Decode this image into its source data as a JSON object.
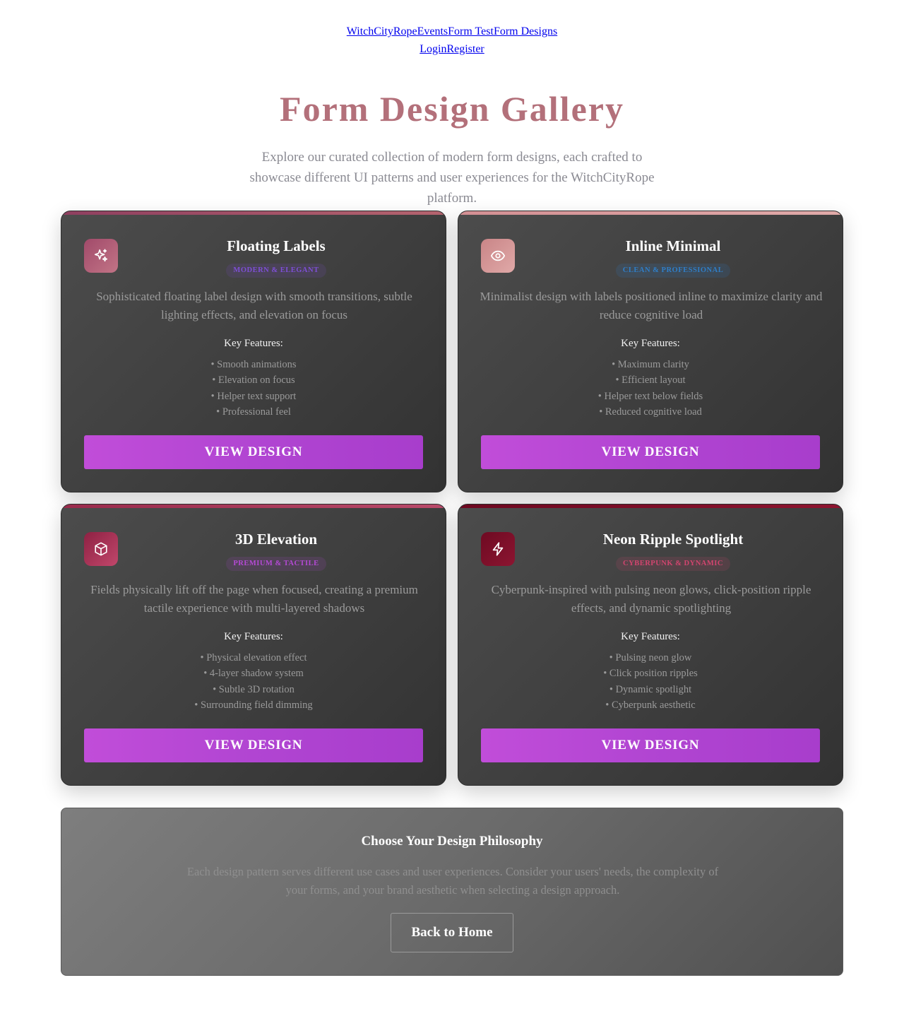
{
  "nav": {
    "row1": [
      "WitchCityRope",
      "Events",
      "Form Test",
      "Form Designs"
    ],
    "row2": [
      "Login",
      "Register"
    ]
  },
  "header": {
    "title": "Form Design Gallery",
    "subtitle": "Explore our curated collection of modern form designs, each crafted to showcase different UI patterns and user experiences for the WitchCityRope platform."
  },
  "cards": [
    {
      "icon": "sparkles-icon",
      "title": "Floating Labels",
      "badge": "MODERN & ELEGANT",
      "badge_color": "#7e4fd6",
      "accent": "#9c4463",
      "description": "Sophisticated floating label design with smooth transitions, subtle lighting effects, and elevation on focus",
      "features_heading": "Key Features:",
      "features": [
        "• Smooth animations",
        "• Elevation on focus",
        "• Helper text support",
        "• Professional feel"
      ],
      "button": "VIEW DESIGN"
    },
    {
      "icon": "eye-icon",
      "title": "Inline Minimal",
      "badge": "CLEAN & PROFESSIONAL",
      "badge_color": "#2f7ec7",
      "accent": "#d6979a",
      "description": "Minimalist design with labels positioned inline to maximize clarity and reduce cognitive load",
      "features_heading": "Key Features:",
      "features": [
        "• Maximum clarity",
        "• Efficient layout",
        "• Helper text below fields",
        "• Reduced cognitive load"
      ],
      "button": "VIEW DESIGN"
    },
    {
      "icon": "cube-icon",
      "title": "3D Elevation",
      "badge": "PREMIUM & TACTILE",
      "badge_color": "#b44ad4",
      "accent": "#a3304f",
      "description": "Fields physically lift off the page when focused, creating a premium tactile experience with multi-layered shadows",
      "features_heading": "Key Features:",
      "features": [
        "• Physical elevation effect",
        "• 4-layer shadow system",
        "• Subtle 3D rotation",
        "• Surrounding field dimming"
      ],
      "button": "VIEW DESIGN"
    },
    {
      "icon": "lightning-icon",
      "title": "Neon Ripple Spotlight",
      "badge": "CYBERPUNK & DYNAMIC",
      "badge_color": "#d2456f",
      "accent": "#7a0b24",
      "description": "Cyberpunk-inspired with pulsing neon glows, click-position ripple effects, and dynamic spotlighting",
      "features_heading": "Key Features:",
      "features": [
        "• Pulsing neon glow",
        "• Click position ripples",
        "• Dynamic spotlight",
        "• Cyberpunk aesthetic"
      ],
      "button": "VIEW DESIGN"
    }
  ],
  "philosophy": {
    "title": "Choose Your Design Philosophy",
    "text": "Each design pattern serves different use cases and user experiences. Consider your users' needs, the complexity of your forms, and your brand aesthetic when selecting a design approach.",
    "button": "Back to Home"
  }
}
